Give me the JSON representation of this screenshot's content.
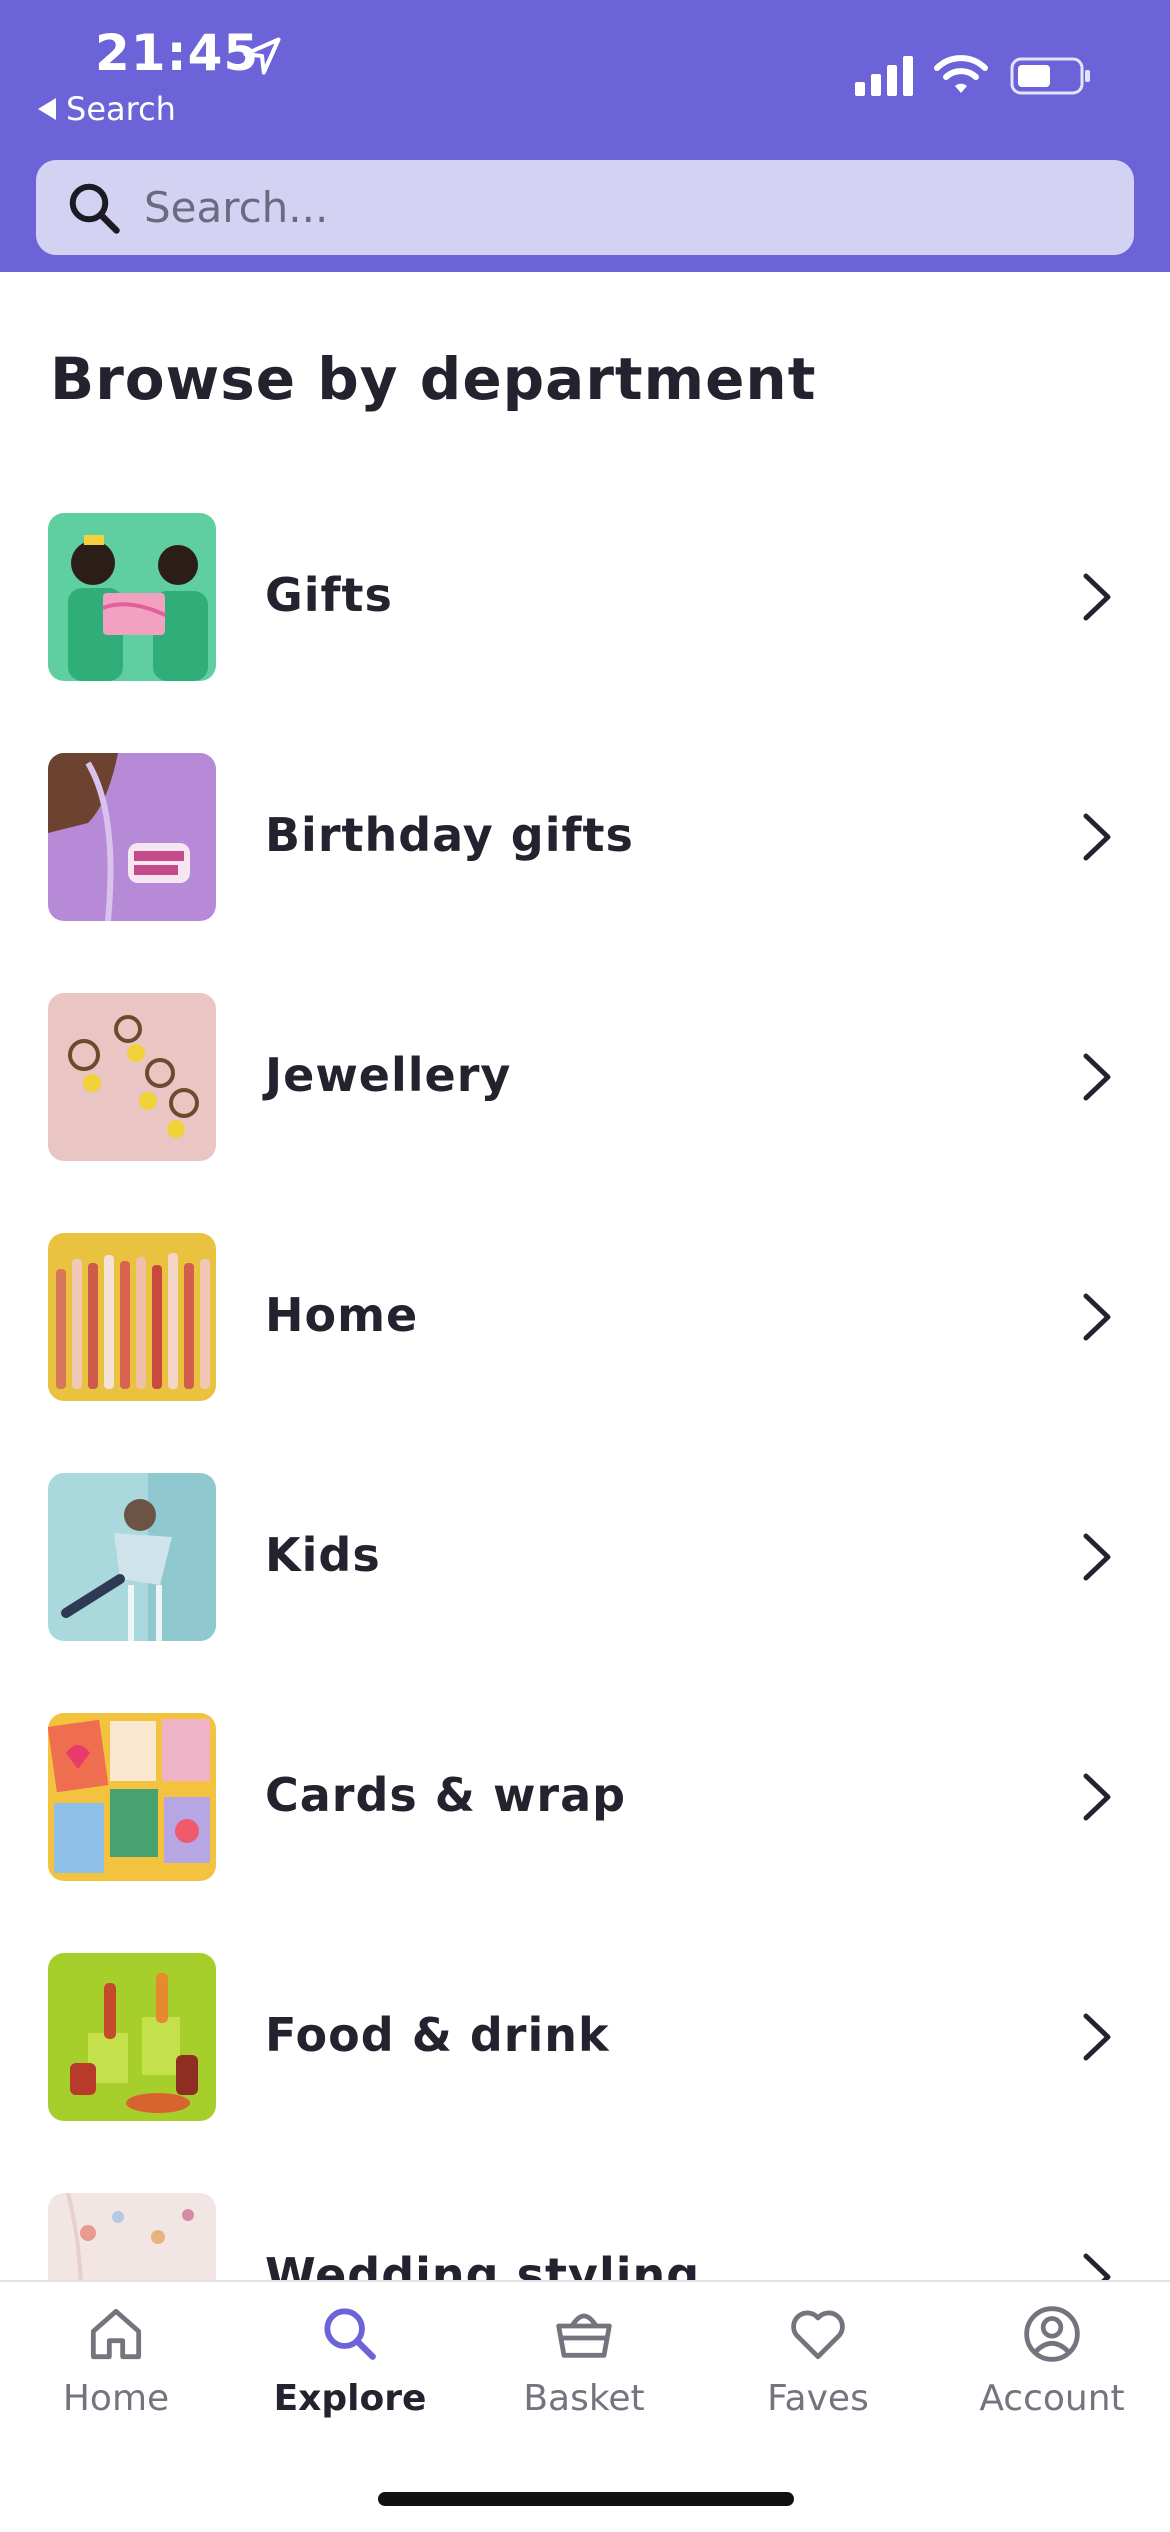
{
  "status_bar": {
    "time": "21:45",
    "back_label": "Search",
    "icons": [
      "location-arrow-icon",
      "signal-icon",
      "wifi-icon",
      "battery-icon"
    ]
  },
  "search": {
    "placeholder": "Search..."
  },
  "section": {
    "title": "Browse by department"
  },
  "departments": [
    {
      "label": "Gifts",
      "thumb": "gifts-image"
    },
    {
      "label": "Birthday gifts",
      "thumb": "birthday-gifts-image"
    },
    {
      "label": "Jewellery",
      "thumb": "jewellery-image"
    },
    {
      "label": "Home",
      "thumb": "home-image"
    },
    {
      "label": "Kids",
      "thumb": "kids-image"
    },
    {
      "label": "Cards & wrap",
      "thumb": "cards-wrap-image"
    },
    {
      "label": "Food & drink",
      "thumb": "food-drink-image"
    },
    {
      "label": "Wedding styling",
      "thumb": "wedding-styling-image"
    }
  ],
  "tabbar": {
    "tabs": [
      {
        "label": "Home",
        "icon": "house-icon",
        "active": false
      },
      {
        "label": "Explore",
        "icon": "search-icon",
        "active": true
      },
      {
        "label": "Basket",
        "icon": "basket-icon",
        "active": false
      },
      {
        "label": "Faves",
        "icon": "heart-icon",
        "active": false
      },
      {
        "label": "Account",
        "icon": "user-circle-icon",
        "active": false
      }
    ]
  },
  "colors": {
    "brand": "#6c63d8",
    "search_bg": "#d3d2f3",
    "text": "#24222e",
    "tab_inactive": "#76737f"
  }
}
